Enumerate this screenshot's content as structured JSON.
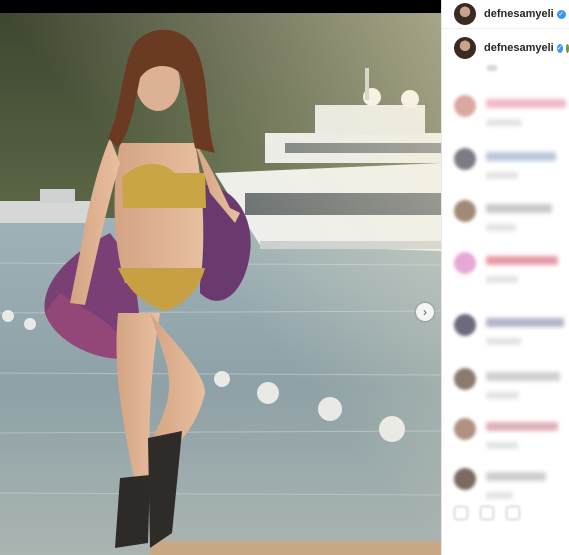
{
  "post": {
    "username": "defnesamyeli",
    "verified": true,
    "carousel_next_label": "›"
  },
  "caption": {
    "username": "defnesamyeli",
    "verified": true,
    "emoji": "green-emoji"
  },
  "comments": [
    {
      "id": 1,
      "avatar_color": "#d9a9a0",
      "line_color": "#f1b9c7"
    },
    {
      "id": 2,
      "avatar_color": "#7b7b86",
      "line_color": "#b9c7da"
    },
    {
      "id": 3,
      "avatar_color": "#a08a77",
      "line_color": "#c9c9c9"
    },
    {
      "id": 4,
      "avatar_color": "#e6a9d6",
      "line_color": "#e79aa6"
    },
    {
      "id": 5,
      "avatar_color": "#6b6b7b",
      "line_color": "#b3b3c9"
    },
    {
      "id": 6,
      "avatar_color": "#8a7a70",
      "line_color": "#d0d0d0"
    },
    {
      "id": 7,
      "avatar_color": "#b09080",
      "line_color": "#e0b0b8"
    },
    {
      "id": 8,
      "avatar_color": "#7a6a60",
      "line_color": "#cfcfcf"
    }
  ],
  "colors": {
    "verified_blue": "#3897f0",
    "topbar": "#000000"
  },
  "actions": [
    "like-icon",
    "comment-icon",
    "share-icon"
  ]
}
